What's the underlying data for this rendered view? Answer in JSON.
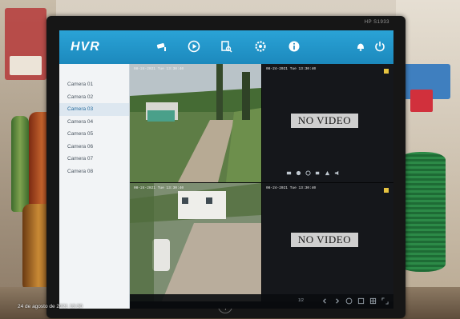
{
  "monitor": {
    "model": "HP S1933"
  },
  "topbar": {
    "title": "HVR",
    "icons": [
      "cctv-camera-icon",
      "playback-icon",
      "search-document-icon",
      "settings-icon",
      "info-icon",
      "alert-bell-icon",
      "power-icon"
    ]
  },
  "sidebar": {
    "cameras": [
      {
        "label": "Camera 01"
      },
      {
        "label": "Camera 02"
      },
      {
        "label": "Camera 03",
        "selected": true
      },
      {
        "label": "Camera 04"
      },
      {
        "label": "Camera 05"
      },
      {
        "label": "Camera 06"
      },
      {
        "label": "Camera 07"
      },
      {
        "label": "Camera 08"
      }
    ]
  },
  "grid": {
    "tiles": [
      {
        "timestamp": "08-24-2021 Tue 13:30:40",
        "status": ""
      },
      {
        "timestamp": "08-24-2021 Tue 13:30:40",
        "status": "NO VIDEO"
      },
      {
        "timestamp": "08-24-2021 Tue 13:30:40",
        "status": ""
      },
      {
        "timestamp": "08-24-2021 Tue 13:30:40",
        "status": "NO VIDEO"
      }
    ]
  },
  "bottombar": {
    "page": "1/2"
  },
  "photo": {
    "date_stamp": "24 de agosto de 2021 13:30"
  },
  "colors": {
    "accent": "#1c89bd",
    "no_video_bg": "#cfcfcf",
    "badge": "#e6c340"
  }
}
